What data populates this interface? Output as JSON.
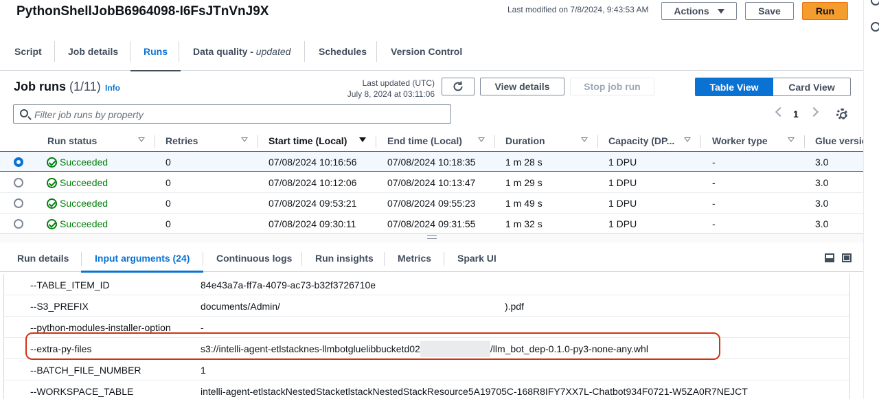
{
  "header": {
    "job_name": "PythonShellJobB6964098-I6FsJTnVnJ9X",
    "last_modified": "Last modified on 7/8/2024, 9:43:53 AM",
    "actions_label": "Actions",
    "save_label": "Save",
    "run_label": "Run"
  },
  "main_tabs": [
    {
      "label": "Script"
    },
    {
      "label": "Job details"
    },
    {
      "label": "Runs",
      "active": true
    },
    {
      "label": "Data quality - ",
      "suffix": "updated"
    },
    {
      "label": "Schedules"
    },
    {
      "label": "Version Control"
    }
  ],
  "runs": {
    "title": "Job runs",
    "count": "(1/11)",
    "info": "Info",
    "last_updated_label": "Last updated (UTC)",
    "last_updated_value": "July 8, 2024 at 03:11:06",
    "view_details": "View details",
    "stop_job_run": "Stop job run",
    "table_view": "Table View",
    "card_view": "Card View",
    "filter_placeholder": "Filter job runs by property",
    "page": "1",
    "columns": [
      "Run status",
      "Retries",
      "Start time (Local)",
      "End time (Local)",
      "Duration",
      "Capacity (DP...",
      "Worker type",
      "Glue versio"
    ],
    "rows": [
      {
        "status": "Succeeded",
        "retries": "0",
        "start": "07/08/2024 10:16:56",
        "end": "07/08/2024 10:18:35",
        "duration": "1 m 28 s",
        "capacity": "1 DPU",
        "worker": "-",
        "glue": "3.0",
        "selected": true
      },
      {
        "status": "Succeeded",
        "retries": "0",
        "start": "07/08/2024 10:12:06",
        "end": "07/08/2024 10:13:47",
        "duration": "1 m 29 s",
        "capacity": "1 DPU",
        "worker": "-",
        "glue": "3.0"
      },
      {
        "status": "Succeeded",
        "retries": "0",
        "start": "07/08/2024 09:53:21",
        "end": "07/08/2024 09:55:23",
        "duration": "1 m 49 s",
        "capacity": "1 DPU",
        "worker": "-",
        "glue": "3.0"
      },
      {
        "status": "Succeeded",
        "retries": "0",
        "start": "07/08/2024 09:30:11",
        "end": "07/08/2024 09:31:55",
        "duration": "1 m 32 s",
        "capacity": "1 DPU",
        "worker": "-",
        "glue": "3.0"
      }
    ]
  },
  "detail_tabs": [
    {
      "label": "Run details"
    },
    {
      "label": "Input arguments (24)",
      "active": true
    },
    {
      "label": "Continuous logs"
    },
    {
      "label": "Run insights"
    },
    {
      "label": "Metrics"
    },
    {
      "label": "Spark UI"
    }
  ],
  "arguments": [
    {
      "key": "--TABLE_ITEM_ID",
      "value": "84e43a7a-ff7a-4079-ac73-b32f3726710e"
    },
    {
      "key": "--S3_PREFIX",
      "value": "documents/Admin/",
      "value_suffix": ").pdf"
    },
    {
      "key": "--python-modules-installer-option",
      "value": "-"
    },
    {
      "key": "--extra-py-files",
      "value": "s3://intelli-agent-etlstacknes-llmbotgluelibbucketd02",
      "value_suffix": "/llm_bot_dep-0.1.0-py3-none-any.whl",
      "highlighted": true
    },
    {
      "key": "--BATCH_FILE_NUMBER",
      "value": "1"
    },
    {
      "key": "--WORKSPACE_TABLE",
      "value": "intelli-agent-etlstackNestedStacketlstackNestedStackResource5A19705C-168R8IFY7XX7L-Chatbot934F0721-W5ZA0R7NEJCT"
    }
  ],
  "colors": {
    "accent": "#0972d3",
    "run_button": "#f49c2e",
    "success": "#037f0c",
    "highlight_box": "#d13212"
  }
}
